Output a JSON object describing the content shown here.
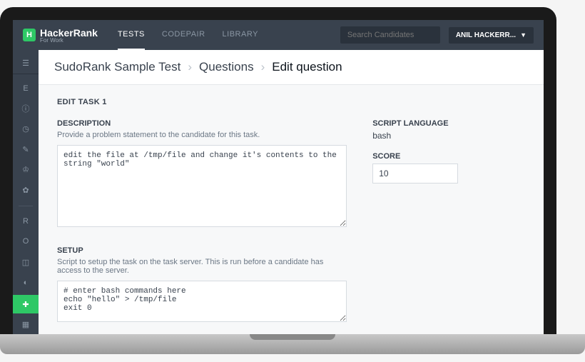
{
  "brand": {
    "name": "HackerRank",
    "subtitle": "For Work",
    "badge_letter": "H"
  },
  "nav": {
    "tabs": [
      "TESTS",
      "CODEPAIR",
      "LIBRARY"
    ],
    "search_placeholder": "Search Candidates",
    "user_label": "ANIL HACKERR..."
  },
  "breadcrumb": {
    "items": [
      "SudoRank Sample Test",
      "Questions",
      "Edit question"
    ]
  },
  "task": {
    "title": "EDIT TASK 1",
    "description": {
      "label": "DESCRIPTION",
      "hint": "Provide a problem statement to the candidate for this task.",
      "value": "edit the file at /tmp/file and change it's contents to the string \"world\""
    },
    "script_language": {
      "label": "SCRIPT LANGUAGE",
      "value": "bash"
    },
    "score": {
      "label": "SCORE",
      "value": "10"
    },
    "setup": {
      "label": "SETUP",
      "hint": "Script to setup the task on the task server. This is run before a candidate has access to the server.",
      "value": "# enter bash commands here\necho \"hello\" > /tmp/file\nexit 0"
    }
  },
  "sidebar": {
    "top_letters": [
      "E"
    ],
    "bottom_letters": [
      "R",
      "O"
    ]
  }
}
